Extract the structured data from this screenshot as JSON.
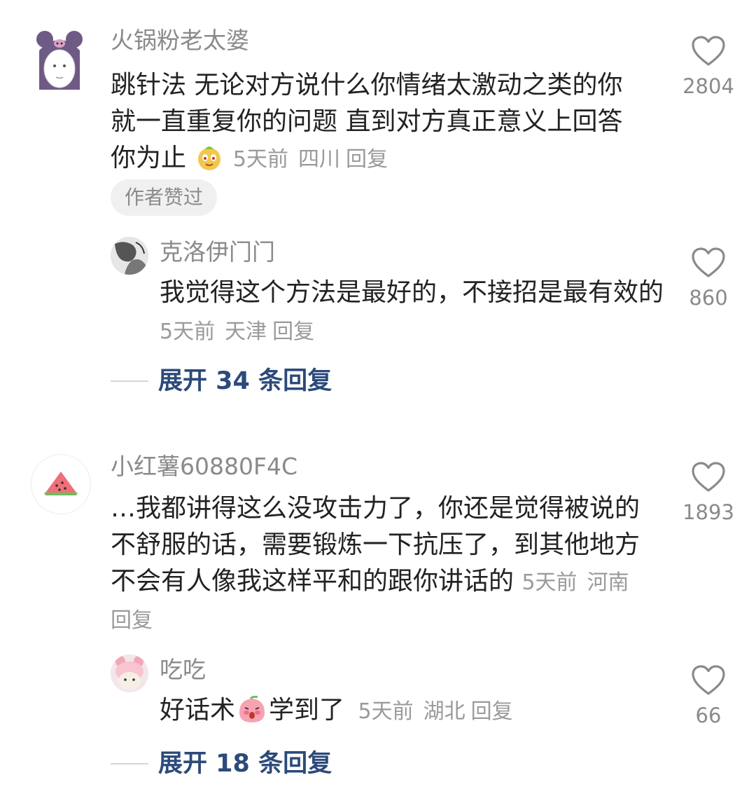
{
  "comments": [
    {
      "username": "火锅粉老太婆",
      "content": "跳针法 无论对方说什么你情绪太激动之类的你就一直重复你的问题 直到对方真正意义上回答你为止",
      "emoji_icon": "smiling-dog-face-emoji",
      "time": "5天前",
      "location": "四川",
      "reply_label": "回复",
      "likes": "2804",
      "badge": "作者赞过",
      "avatar_icon": "kuromi-avatar",
      "reply": {
        "username": "克洛伊门门",
        "content": "我觉得这个方法是最好的，不接招是最有效的",
        "time": "5天前",
        "location": "天津",
        "reply_label": "回复",
        "likes": "860",
        "avatar_icon": "sketch-portrait-avatar"
      },
      "expand_label": "展开 34 条回复"
    },
    {
      "username": "小红薯60880F4C",
      "content": "…我都讲得这么没攻击力了，你还是觉得被说的不舒服的话，需要锻炼一下抗压了，到其他地方不会有人像我这样平和的跟你讲话的",
      "time": "5天前",
      "location": "河南",
      "reply_label": "回复",
      "likes": "1893",
      "avatar_icon": "watermelon-avatar",
      "reply": {
        "username": "吃吃",
        "content_before": "好话术",
        "emoji_icon": "blushing-peach-emoji",
        "content_after": "学到了",
        "time": "5天前",
        "location": "湖北",
        "reply_label": "回复",
        "likes": "66",
        "avatar_icon": "cat-in-pig-hat-avatar"
      },
      "expand_label": "展开 18 条回复"
    }
  ],
  "colors": {
    "name": "#8a8a8a",
    "text": "#222222",
    "meta": "#9a9a9a",
    "expand": "#2c4a7a",
    "heart": "#8a8a8a",
    "badge_bg": "#f0f0f0"
  }
}
